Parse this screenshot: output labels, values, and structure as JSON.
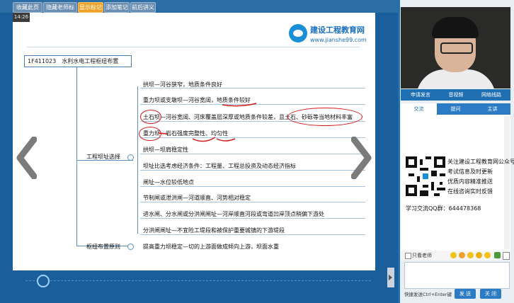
{
  "toolbar": {
    "buttons": [
      "收藏此页",
      "隐藏老师标记",
      "显示标记",
      "添加笔记",
      "前后讲义"
    ],
    "active_index": 2
  },
  "slide": {
    "time": "14:26",
    "logo_name": "建设工程教育网",
    "logo_url": "www.jianshe99.com",
    "title": "1F411023　水利水电工程枢纽布置",
    "branch_site": "工程坝址选择",
    "branch_layout": "枢纽布置原则",
    "items": [
      "拱坝—河谷狭窄，地质条件良好",
      "重力坝或支墩坝—河谷宽阔，地质条件较好",
      "土石坝—河谷宽阔、河床覆盖层深厚或地质条件较差，且土石、砂砾等当地材料丰富",
      "重力坝—岩石强度完整性、均匀性",
      "拱坝—坝肩稳定性",
      "坝址比选考虑经济条件：工程量、工程总投资及动态经济指标",
      "闸址—水位较低地点",
      "节制闸或泄洪闸—河道顺直、河势相对稳定",
      "进水闸、分水闸或分洪闸闸址—河岸顺直河段或弯道凹岸顶点稍偏下游处",
      "分洪闸闸址—不宜险工堤段和被保护重要城镇的下游堤段",
      "提高重力坝稳定—切的上游面做成倾向上游，坝面水重"
    ]
  },
  "video_buttons": [
    "申请发言",
    "音视频",
    "网络线路"
  ],
  "tabs": [
    "交流",
    "提问",
    "主讲"
  ],
  "active_tab": 0,
  "chat": {
    "promo_lines": [
      "关注建设工程教育网公众号",
      "考试信息及时更新",
      "优质内容精准推送",
      "在线咨询实时反馈"
    ],
    "qq_group": "学习交流QQ群：644478368"
  },
  "chat_tools": {
    "only_teacher": "只看老师"
  },
  "input": {
    "hint": "快捷发送Ctrl+Enter键",
    "send": "发 送",
    "close": "关 闭"
  },
  "colors": {
    "accent": "#1f6fb3",
    "active_button": "#f0a12a",
    "ink": "#d21a1a"
  }
}
